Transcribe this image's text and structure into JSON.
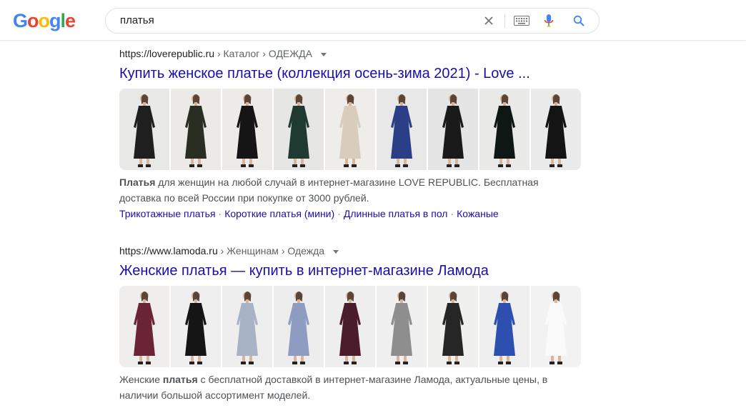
{
  "search": {
    "query": "платья",
    "icons": [
      "close-icon",
      "keyboard-icon",
      "mic-icon",
      "search-icon"
    ]
  },
  "logo": {
    "letters": [
      "G",
      "o",
      "o",
      "g",
      "l",
      "e"
    ],
    "colors": [
      "#4285f4",
      "#ea4335",
      "#fbbc05",
      "#4285f4",
      "#34a853",
      "#ea4335"
    ]
  },
  "results": [
    {
      "url": "https://loverepublic.ru",
      "path": "› Каталог › ОДЕЖДА",
      "title": "Купить женское платье (коллекция осень-зима 2021) - Love ...",
      "images": [
        {
          "bg": "#e8e8e6",
          "dress": "#1f1f1f"
        },
        {
          "bg": "#eceae6",
          "dress": "#2a2d22"
        },
        {
          "bg": "#ecebe8",
          "dress": "#151515"
        },
        {
          "bg": "#e6e7e5",
          "dress": "#1f3a30"
        },
        {
          "bg": "#efede9",
          "dress": "#d8cdbd"
        },
        {
          "bg": "#e8e8e9",
          "dress": "#2a3f86"
        },
        {
          "bg": "#e5e5e5",
          "dress": "#1a1a1a"
        },
        {
          "bg": "#e9e9e7",
          "dress": "#0f1714"
        },
        {
          "bg": "#eaeaea",
          "dress": "#141414"
        }
      ],
      "snippet_bold": "Платья",
      "snippet_rest": " для женщин на любой случай в интернет-магазине LOVE REPUBLIC. Бесплатная доставка по всей России при покупке от 3000 рублей.",
      "sitelinks": [
        "Трикотажные платья",
        "Короткие платья (мини)",
        "Длинные платья в пол",
        "Кожаные"
      ]
    },
    {
      "url": "https://www.lamoda.ru",
      "path": "› Женщинам › Одежда",
      "title": "Женские платья — купить в интернет-магазине Ламода",
      "images": [
        {
          "bg": "#f0eeec",
          "dress": "#6b2436"
        },
        {
          "bg": "#efefef",
          "dress": "#151515"
        },
        {
          "bg": "#eeeeee",
          "dress": "#a7b3c4"
        },
        {
          "bg": "#ededee",
          "dress": "#8d9cc0"
        },
        {
          "bg": "#efeeee",
          "dress": "#4a1c2c"
        },
        {
          "bg": "#f0f0f0",
          "dress": "#8e8e8e"
        },
        {
          "bg": "#f0f0ef",
          "dress": "#262626"
        },
        {
          "bg": "#efefef",
          "dress": "#2d4fb0"
        },
        {
          "bg": "#f2f2f2",
          "dress": "#fafafa"
        }
      ],
      "snippet_pre": "Женские ",
      "snippet_bold": "платья",
      "snippet_rest": " с бесплатной доставкой в интернет-магазине Ламода, актуальные цены, в наличии большой ассортимент моделей."
    }
  ]
}
